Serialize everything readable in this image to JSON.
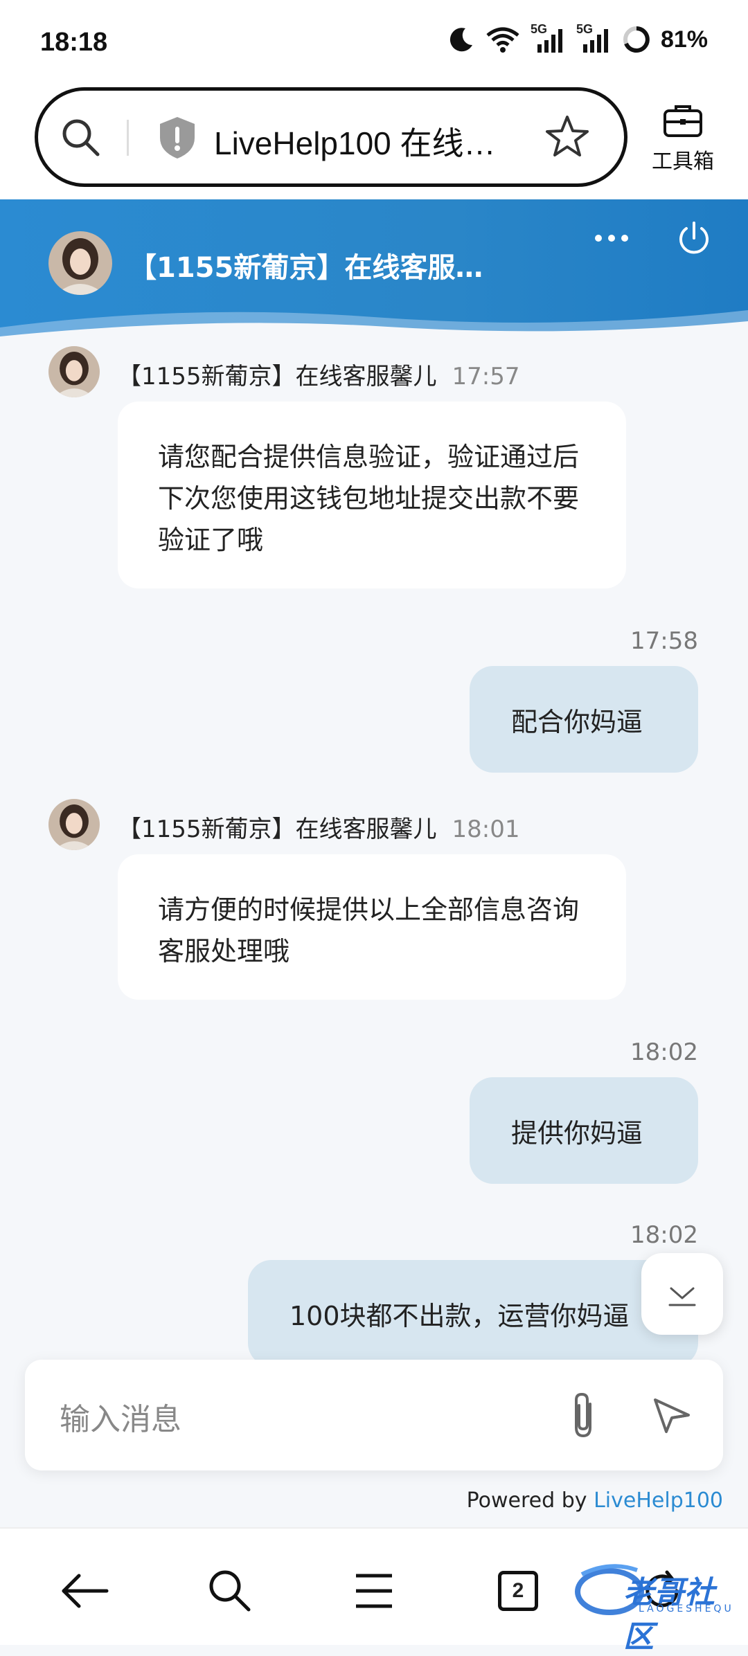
{
  "status_bar": {
    "time": "18:18",
    "battery": "81%",
    "signal1": "5G",
    "signal2": "5G"
  },
  "browser": {
    "url": "LiveHelp100 在线…",
    "toolbox_label": "工具箱"
  },
  "chat": {
    "title": "【1155新葡京】在线客服…",
    "messages": [
      {
        "sender": "【1155新葡京】在线客服馨儿",
        "time": "17:57",
        "text": "请您配合提供信息验证，验证通过后下次您使用这钱包地址提交出款不要验证了哦"
      },
      {
        "time": "17:58",
        "text": "配合你妈逼"
      },
      {
        "sender": "【1155新葡京】在线客服馨儿",
        "time": "18:01",
        "text": "请方便的时候提供以上全部信息咨询客服处理哦"
      },
      {
        "time": "18:02",
        "text": "提供你妈逼"
      },
      {
        "time": "18:02",
        "text": "100块都不出款，运营你妈逼"
      }
    ],
    "input_placeholder": "输入消息",
    "powered_by": "Powered by",
    "powered_link": "LiveHelp100"
  },
  "nav": {
    "tab_count": "2"
  },
  "watermark": {
    "text": "老哥社区",
    "sub": "LAOGESHEQU"
  },
  "colors": {
    "header": "#2b8bd2",
    "bubble_out": "#d7e6f0",
    "link": "#2b8bd2"
  }
}
